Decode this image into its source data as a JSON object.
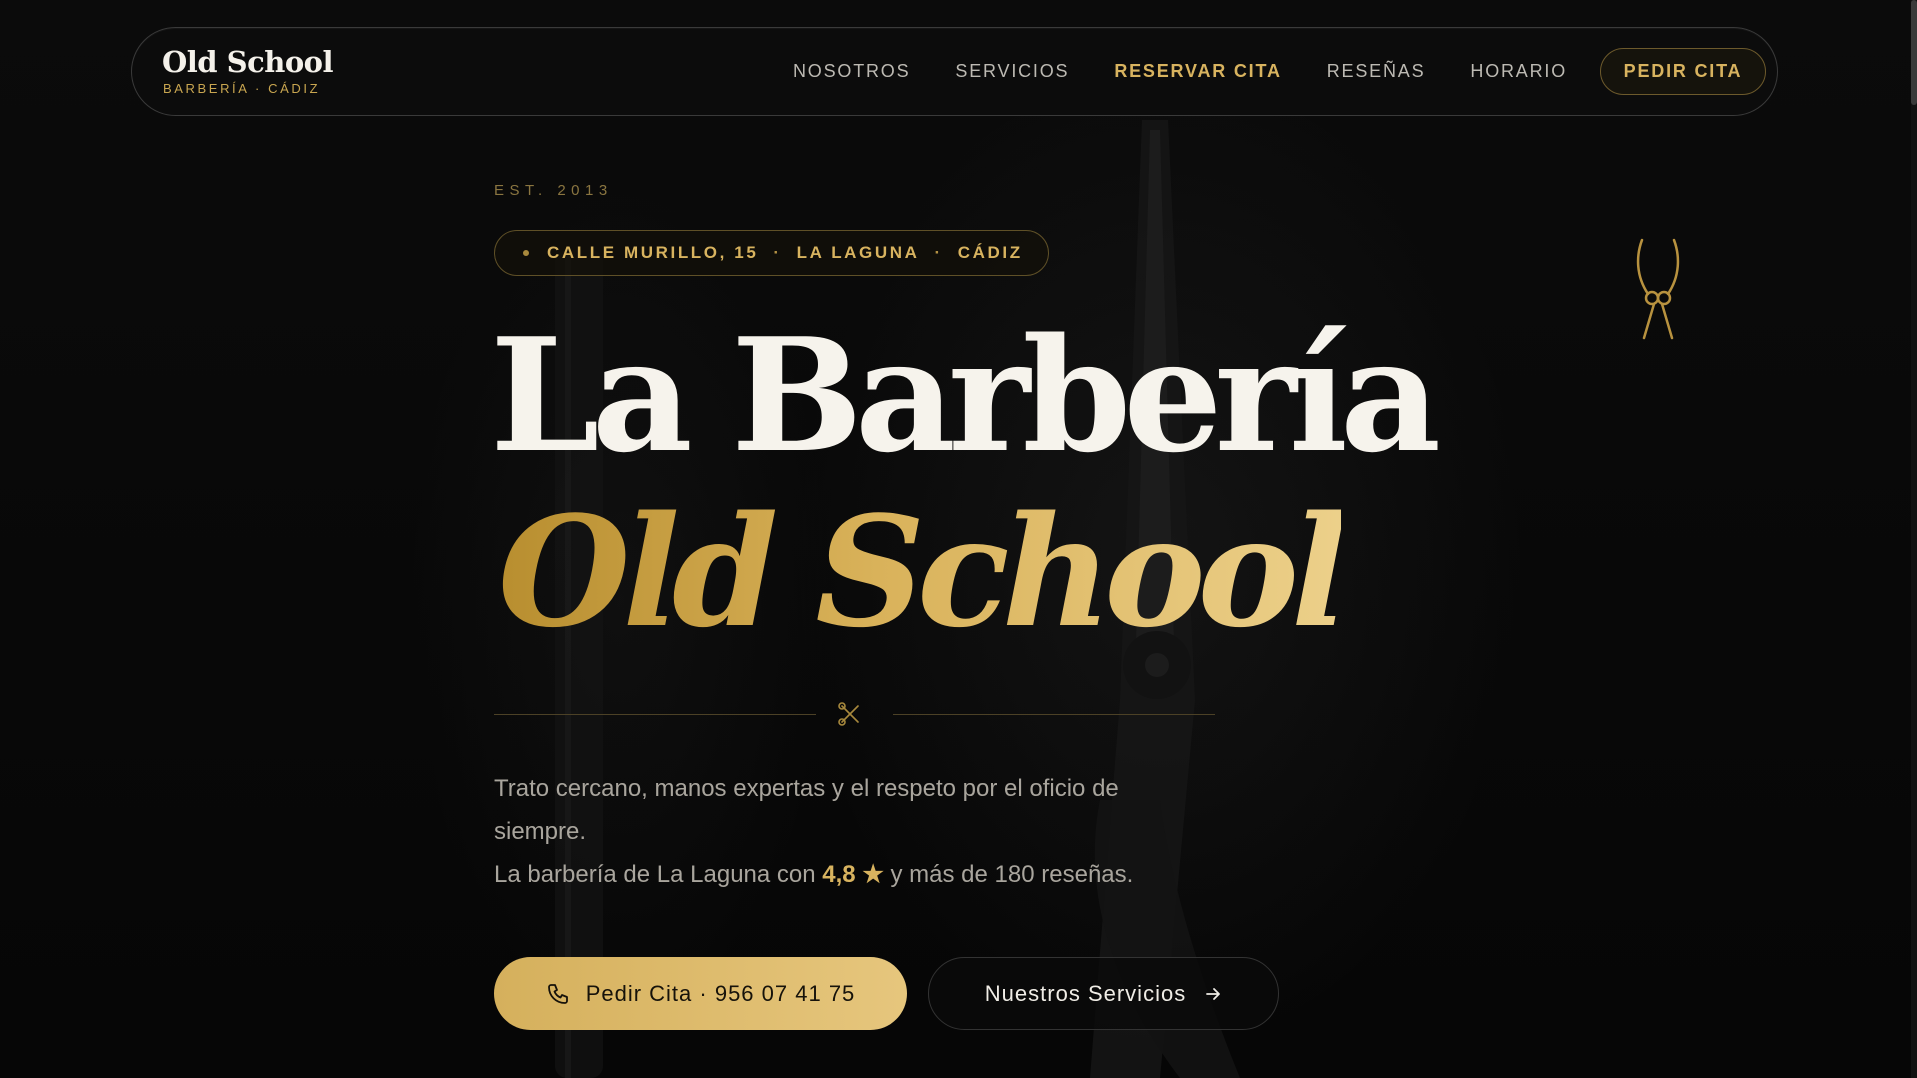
{
  "brand": {
    "name": "Old School",
    "subtitle": "BARBERÍA · CÁDIZ"
  },
  "nav": {
    "links": [
      {
        "label": "NOSOTROS"
      },
      {
        "label": "SERVICIOS"
      },
      {
        "label": "RESERVAR CITA",
        "active": true
      },
      {
        "label": "RESEÑAS"
      },
      {
        "label": "HORARIO"
      }
    ],
    "cta_label": "PEDIR CITA"
  },
  "hero": {
    "established": "EST. 2013",
    "address": {
      "street": "CALLE MURILLO, 15",
      "separator": "·",
      "neighborhood": "LA LAGUNA",
      "city": "CÁDIZ"
    },
    "title_line1": "La Barbería",
    "title_line2": "Old School",
    "description_line1": "Trato cercano, manos expertas y el respeto por el oficio de siempre.",
    "description_line2_prefix": "La barbería de La Laguna con",
    "rating": "4,8 ★",
    "description_line2_suffix": "y más de 180 reseñas.",
    "primary_button_label": "Pedir Cita · 956 07 41 75",
    "secondary_button_label": "Nuestros Servicios"
  },
  "icons": {
    "phone": "phone-icon",
    "arrow": "arrow-right-icon",
    "divider": "scissors-icon",
    "decor": "scissors-icon"
  },
  "colors": {
    "accent_gold": "#d8b35f",
    "background": "#080808",
    "text_light": "#f6f3ec",
    "text_muted": "#a9a59d"
  }
}
